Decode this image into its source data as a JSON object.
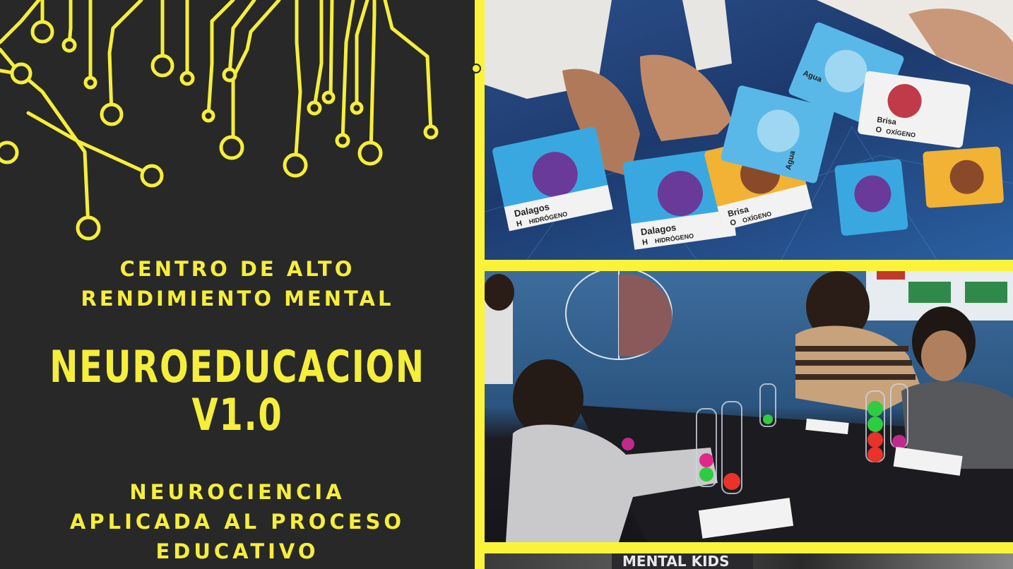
{
  "poster": {
    "subtitle_line1": "CENTRO DE ALTO",
    "subtitle_line2": "RENDIMIENTO MENTAL",
    "title_line1": "NEUROEDUCACION",
    "title_line2": "V1.0",
    "tagline_line1": "NEUROCIENCIA",
    "tagline_line2": "APLICADA AL PROCESO",
    "tagline_line3": "EDUCATIVO"
  },
  "colors": {
    "accent": "#f5ee3a",
    "panel_bg": "#282828",
    "frame": "#fbf33a"
  },
  "cards": [
    {
      "name": "Dalagos",
      "element": "HIDRÓGENO",
      "symbol": "H"
    },
    {
      "name": "Dalagos",
      "element": "HIDRÓGENO",
      "symbol": "H"
    },
    {
      "name": "Brisa",
      "element": "OXÍGENO",
      "symbol": "O"
    },
    {
      "name": "Agua",
      "element": "",
      "symbol": ""
    },
    {
      "name": "Agua",
      "element": "",
      "symbol": ""
    },
    {
      "name": "Brisa",
      "element": "OXÍGENO",
      "symbol": "O"
    }
  ],
  "bottom_sign": "MENTAL KIDS"
}
